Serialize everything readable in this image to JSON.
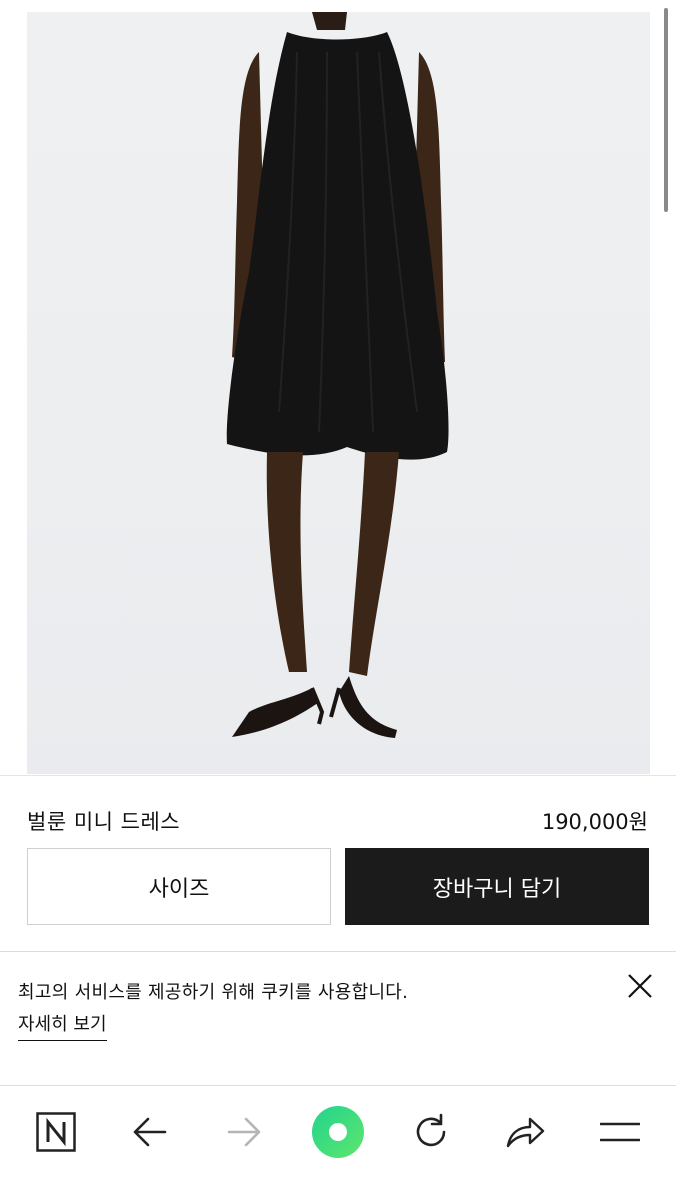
{
  "product": {
    "name": "벌룬 미니 드레스",
    "price": "190,000원",
    "image_alt": "product-photo"
  },
  "actions": {
    "size_label": "사이즈",
    "cart_label": "장바구니 담기"
  },
  "cookie_banner": {
    "message": "최고의 서비스를 제공하기 위해 쿠키를 사용합니다.",
    "details_link": "자세히 보기",
    "close_icon": "close-icon"
  },
  "toolbar": {
    "items": [
      {
        "icon": "naver-n-icon"
      },
      {
        "icon": "arrow-left-icon"
      },
      {
        "icon": "arrow-right-icon",
        "state": "disabled"
      },
      {
        "icon": "green-circle-icon"
      },
      {
        "icon": "refresh-icon"
      },
      {
        "icon": "share-icon"
      },
      {
        "icon": "menu-icon"
      }
    ]
  },
  "colors": {
    "cart_button_bg": "#1b1b1b",
    "green_button": "#3ddc84",
    "photo_background": "#eceef0"
  }
}
